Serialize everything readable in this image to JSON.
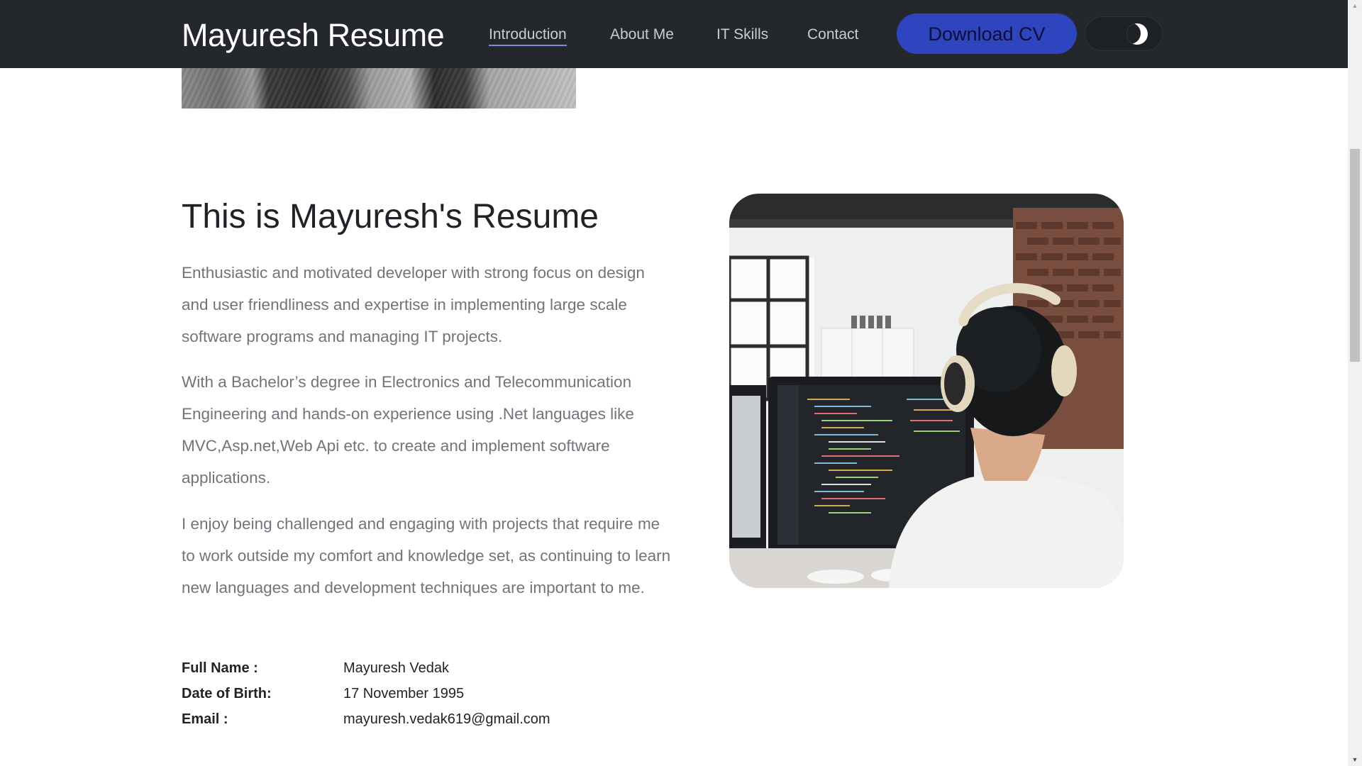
{
  "navbar": {
    "brand": "Mayuresh Resume",
    "links": [
      {
        "label": "Introduction",
        "active": true
      },
      {
        "label": "About Me",
        "active": false
      },
      {
        "label": "IT Skills",
        "active": false
      },
      {
        "label": "Contact",
        "active": false
      }
    ],
    "download_label": "Download CV",
    "theme_toggle_icon": "moon-icon"
  },
  "intro": {
    "title": "This is Mayuresh's Resume",
    "paragraphs": [
      "Enthusiastic and motivated developer with strong focus on design and user friendliness and expertise in implementing large scale software programs and managing IT projects.",
      "With a Bachelor’s degree in Electronics and Telecommunication Engineering and hands-on experience using .Net languages like MVC,Asp.net,Web Api etc. to create and implement software applications.",
      "I enjoy being challenged and engaging with projects that require me to work outside my comfort and knowledge set, as continuing to learn new languages and development techniques are important to me."
    ],
    "details": [
      {
        "label": "Full Name :",
        "value": "Mayuresh Vedak"
      },
      {
        "label": "Date of Birth:",
        "value": "17 November 1995"
      },
      {
        "label": "Email :",
        "value": "mayuresh.vedak619@gmail.com"
      }
    ]
  },
  "colors": {
    "navbar_bg": "#24272b",
    "accent": "#2f45c0",
    "body_text": "#6f757b",
    "heading_text": "#1f2328"
  }
}
